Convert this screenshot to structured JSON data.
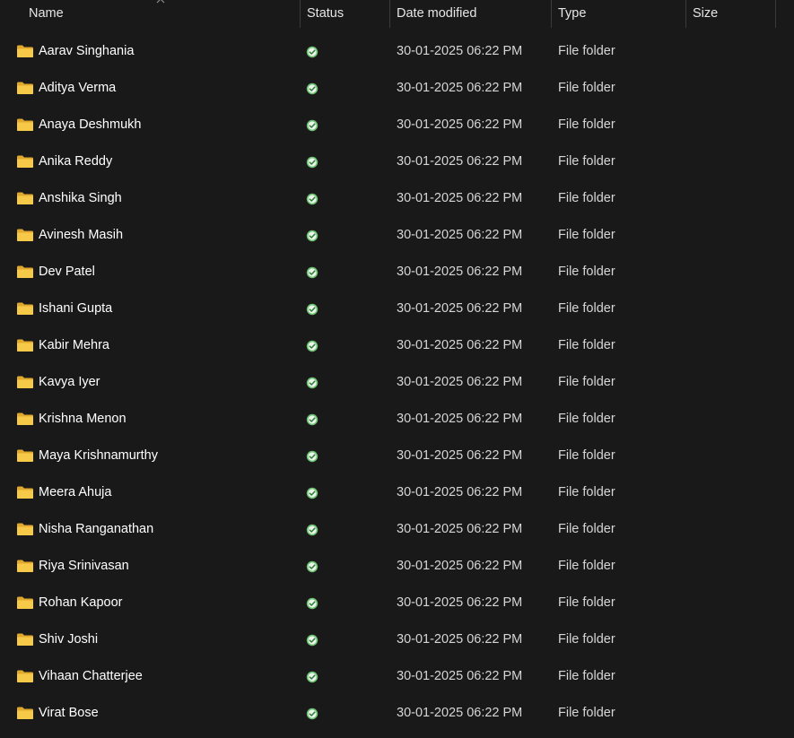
{
  "columns": {
    "name": "Name",
    "status": "Status",
    "date_modified": "Date modified",
    "type": "Type",
    "size": "Size"
  },
  "sort": {
    "column": "Name",
    "direction": "ascending",
    "icon": "chevron-up-icon"
  },
  "icons": {
    "folder": "folder-icon",
    "status": "synced-check-icon"
  },
  "colors": {
    "background": "#191919",
    "folder": "#f7c948",
    "status_check": "#6cc070"
  },
  "rows": [
    {
      "name": "Aarav Singhania",
      "date": "30-01-2025 06:22 PM",
      "type": "File folder",
      "size": ""
    },
    {
      "name": "Aditya Verma",
      "date": "30-01-2025 06:22 PM",
      "type": "File folder",
      "size": ""
    },
    {
      "name": "Anaya Deshmukh",
      "date": "30-01-2025 06:22 PM",
      "type": "File folder",
      "size": ""
    },
    {
      "name": "Anika Reddy",
      "date": "30-01-2025 06:22 PM",
      "type": "File folder",
      "size": ""
    },
    {
      "name": "Anshika Singh",
      "date": "30-01-2025 06:22 PM",
      "type": "File folder",
      "size": ""
    },
    {
      "name": "Avinesh Masih",
      "date": "30-01-2025 06:22 PM",
      "type": "File folder",
      "size": ""
    },
    {
      "name": "Dev Patel",
      "date": "30-01-2025 06:22 PM",
      "type": "File folder",
      "size": ""
    },
    {
      "name": "Ishani Gupta",
      "date": "30-01-2025 06:22 PM",
      "type": "File folder",
      "size": ""
    },
    {
      "name": "Kabir Mehra",
      "date": "30-01-2025 06:22 PM",
      "type": "File folder",
      "size": ""
    },
    {
      "name": "Kavya Iyer",
      "date": "30-01-2025 06:22 PM",
      "type": "File folder",
      "size": ""
    },
    {
      "name": "Krishna Menon",
      "date": "30-01-2025 06:22 PM",
      "type": "File folder",
      "size": ""
    },
    {
      "name": "Maya Krishnamurthy",
      "date": "30-01-2025 06:22 PM",
      "type": "File folder",
      "size": ""
    },
    {
      "name": "Meera Ahuja",
      "date": "30-01-2025 06:22 PM",
      "type": "File folder",
      "size": ""
    },
    {
      "name": "Nisha Ranganathan",
      "date": "30-01-2025 06:22 PM",
      "type": "File folder",
      "size": ""
    },
    {
      "name": "Riya Srinivasan",
      "date": "30-01-2025 06:22 PM",
      "type": "File folder",
      "size": ""
    },
    {
      "name": "Rohan Kapoor",
      "date": "30-01-2025 06:22 PM",
      "type": "File folder",
      "size": ""
    },
    {
      "name": "Shiv Joshi",
      "date": "30-01-2025 06:22 PM",
      "type": "File folder",
      "size": ""
    },
    {
      "name": "Vihaan Chatterjee",
      "date": "30-01-2025 06:22 PM",
      "type": "File folder",
      "size": ""
    },
    {
      "name": "Virat Bose",
      "date": "30-01-2025 06:22 PM",
      "type": "File folder",
      "size": ""
    }
  ]
}
